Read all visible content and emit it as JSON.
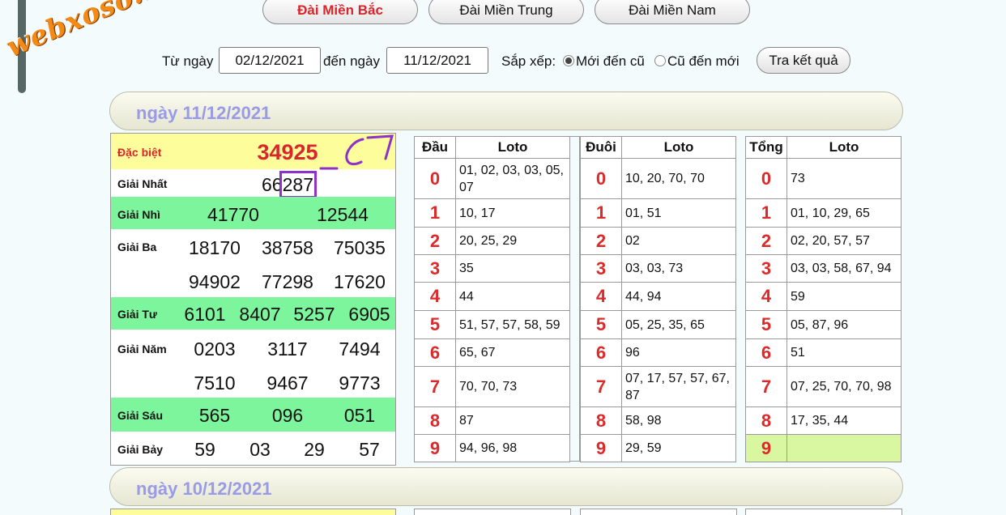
{
  "watermark": "webxoso.net",
  "regions": [
    {
      "label": "Đài Miền Bắc",
      "active": true
    },
    {
      "label": "Đài Miền Trung",
      "active": false
    },
    {
      "label": "Đài Miền Nam",
      "active": false
    }
  ],
  "filter": {
    "from_label": "Từ ngày",
    "from_value": "02/12/2021",
    "to_label": "đến ngày",
    "to_value": "11/12/2021",
    "sort_label": "Sắp xếp:",
    "sort_new": "Mới đến cũ",
    "sort_old": "Cũ đến mới",
    "search_button": "Tra kết quả"
  },
  "days": [
    {
      "title": "ngày 11/12/2021"
    },
    {
      "title": "ngày 10/12/2021"
    }
  ],
  "prizes": {
    "special_label": "Đặc biệt",
    "special_value": "34925",
    "first_label": "Giải Nhất",
    "first_value": "66287",
    "first_prefix": "66",
    "first_suffix": "287",
    "second_label": "Giải Nhì",
    "second_values": [
      "41770",
      "12544"
    ],
    "third_label": "Giải Ba",
    "third_values": [
      "18170",
      "38758",
      "75035",
      "94902",
      "77298",
      "17620"
    ],
    "fourth_label": "Giải Tư",
    "fourth_values": [
      "6101",
      "8407",
      "5257",
      "6905"
    ],
    "fifth_label": "Giải Năm",
    "fifth_values": [
      "0203",
      "3117",
      "7494",
      "7510",
      "9467",
      "9773"
    ],
    "sixth_label": "Giải Sáu",
    "sixth_values": [
      "565",
      "096",
      "051"
    ],
    "seventh_label": "Giải Bảy",
    "seventh_values": [
      "59",
      "03",
      "29",
      "57"
    ]
  },
  "dau_table": {
    "head_col": "Đầu",
    "loto_col": "Loto",
    "rows": [
      {
        "d": "0",
        "v": "01, 02, 03, 03, 05, 07"
      },
      {
        "d": "1",
        "v": "10, 17"
      },
      {
        "d": "2",
        "v": "20, 25, 29"
      },
      {
        "d": "3",
        "v": "35"
      },
      {
        "d": "4",
        "v": "44"
      },
      {
        "d": "5",
        "v": "51, 57, 57, 58, 59"
      },
      {
        "d": "6",
        "v": "65, 67"
      },
      {
        "d": "7",
        "v": "70, 70, 73"
      },
      {
        "d": "8",
        "v": "87"
      },
      {
        "d": "9",
        "v": "94, 96, 98"
      }
    ]
  },
  "duoi_table": {
    "head_col": "Đuôi",
    "loto_col": "Loto",
    "rows": [
      {
        "d": "0",
        "v": "10, 20, 70, 70"
      },
      {
        "d": "1",
        "v": "01, 51"
      },
      {
        "d": "2",
        "v": "02"
      },
      {
        "d": "3",
        "v": "03, 03, 73"
      },
      {
        "d": "4",
        "v": "44, 94"
      },
      {
        "d": "5",
        "v": "05, 25, 35, 65"
      },
      {
        "d": "6",
        "v": "96"
      },
      {
        "d": "7",
        "v": "07, 17, 57, 57, 67, 87"
      },
      {
        "d": "8",
        "v": "58, 98"
      },
      {
        "d": "9",
        "v": "29, 59"
      }
    ]
  },
  "tong_table": {
    "head_col": "Tổng",
    "loto_col": "Loto",
    "rows": [
      {
        "d": "0",
        "v": "73"
      },
      {
        "d": "1",
        "v": "01, 10, 29, 65"
      },
      {
        "d": "2",
        "v": "02, 20, 57, 57"
      },
      {
        "d": "3",
        "v": "03, 03, 58, 67, 94"
      },
      {
        "d": "4",
        "v": "59"
      },
      {
        "d": "5",
        "v": "05, 87, 96"
      },
      {
        "d": "6",
        "v": "51"
      },
      {
        "d": "7",
        "v": "07, 25, 70, 70, 98"
      },
      {
        "d": "8",
        "v": "17, 35, 44"
      },
      {
        "d": "9",
        "v": ""
      }
    ]
  },
  "colors": {
    "special_row": "#fdfd9c",
    "green_row": "#7cf59c",
    "digit_red": "#dc2a2a",
    "annotation_purple": "#8e30c9",
    "tong_highlight": "#d8f7a0"
  }
}
